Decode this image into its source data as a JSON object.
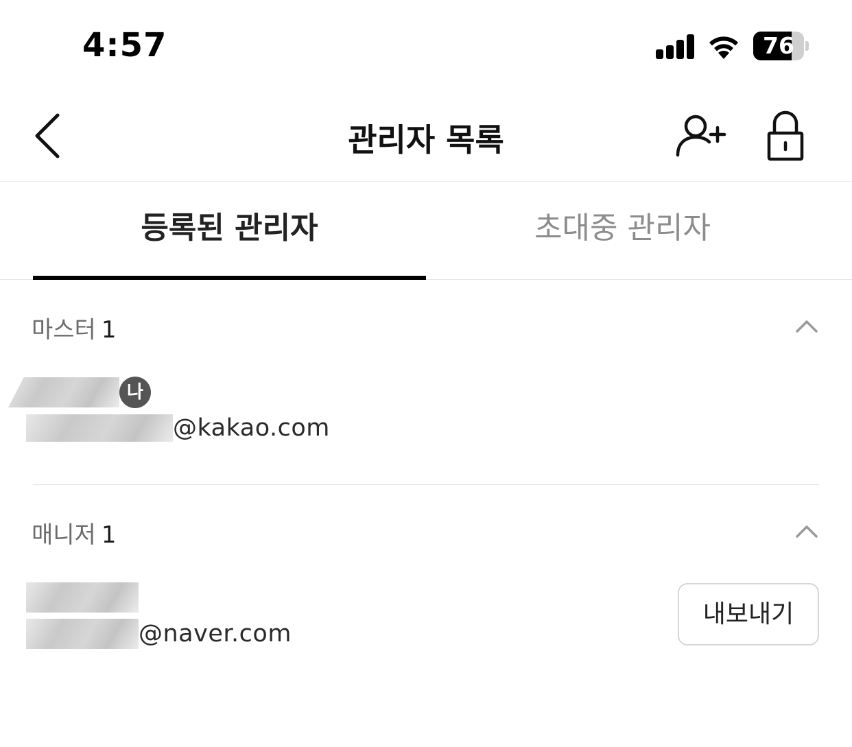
{
  "status_bar": {
    "time": "4:57",
    "battery_level": "76",
    "battery_fraction": 0.76
  },
  "nav": {
    "title": "관리자 목록",
    "icons": {
      "back": "chevron-left-icon",
      "add_user": "add-user-icon",
      "lock": "lock-icon"
    }
  },
  "tabs": [
    {
      "label": "등록된 관리자",
      "active": true
    },
    {
      "label": "초대중 관리자",
      "active": false
    }
  ],
  "sections": {
    "master": {
      "label": "마스터",
      "count": "1",
      "expanded": true,
      "members": [
        {
          "me_badge": "나",
          "email_domain": "@kakao.com"
        }
      ]
    },
    "manager": {
      "label": "매니저",
      "count": "1",
      "expanded": true,
      "members": [
        {
          "email_domain": "@naver.com",
          "action_label": "내보내기"
        }
      ]
    }
  },
  "colors": {
    "tab_underline": "#000000",
    "inactive_tab": "#8c8c8c",
    "section_label": "#6b6b6b",
    "me_badge": "#555555"
  }
}
